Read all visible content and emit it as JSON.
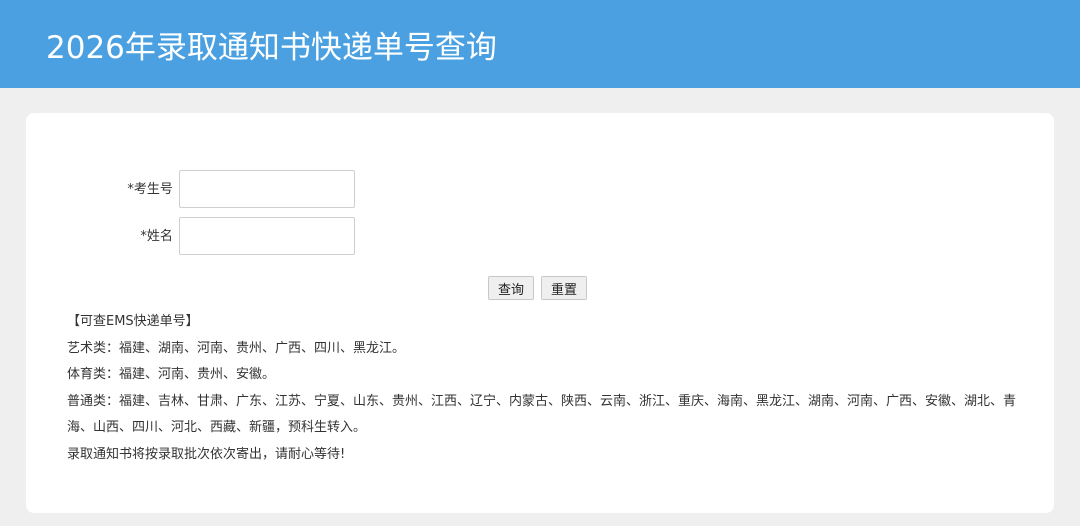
{
  "header": {
    "title": "2026年录取通知书快递单号查询"
  },
  "form": {
    "fields": [
      {
        "label": "*考生号 ：",
        "value": "",
        "placeholder": ""
      },
      {
        "label": "*姓名 ：",
        "value": "",
        "placeholder": ""
      }
    ],
    "query_label": "查询",
    "reset_label": "重置"
  },
  "info": {
    "heading": "【可查EMS快递单号】",
    "lines": [
      "艺术类：福建、湖南、河南、贵州、广西、四川、黑龙江。",
      "体育类：福建、河南、贵州、安徽。",
      "普通类：福建、吉林、甘肃、广东、江苏、宁夏、山东、贵州、江西、辽宁、内蒙古、陕西、云南、浙江、重庆、海南、黑龙江、湖南、河南、广西、安徽、湖北、青海、山西、四川、河北、西藏、新疆，预科生转入。",
      "录取通知书将按录取批次依次寄出，请耐心等待!"
    ]
  },
  "colors": {
    "header_bg": "#4aa0e0",
    "page_bg": "#efefef",
    "card_bg": "#ffffff"
  }
}
